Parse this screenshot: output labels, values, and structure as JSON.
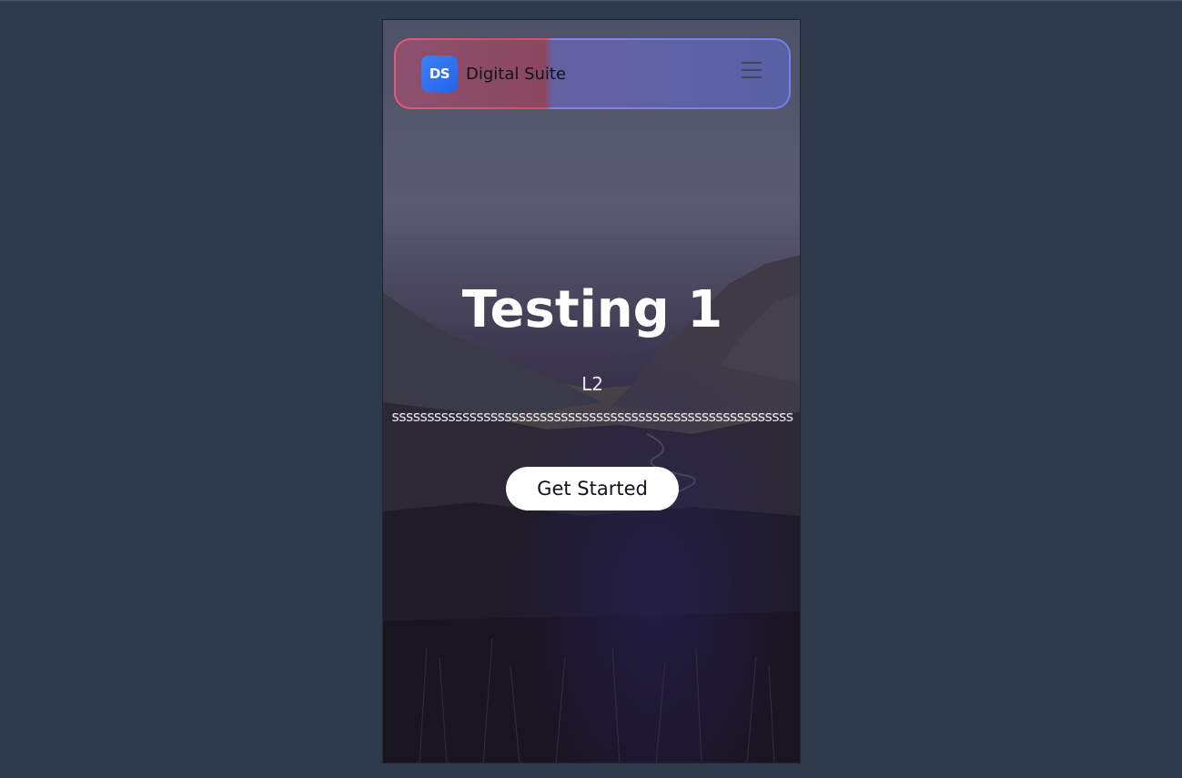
{
  "navbar": {
    "logo_initials": "DS",
    "brand_name": "Digital Suite",
    "menu_icon": "hamburger-menu-icon"
  },
  "hero": {
    "title": "Testing 1",
    "line2": "L2",
    "long_text": "sssssssssssssssssssssssssssssssssssssssssssssssssssssssss",
    "cta_label": "Get Started"
  },
  "colors": {
    "page_background": "#2f3a4a",
    "logo_gradient_start": "#3b82f6",
    "logo_gradient_end": "#2563eb",
    "nav_border_left": "#e0485a",
    "nav_border_right": "#6f7ff0",
    "cta_background": "#ffffff"
  }
}
